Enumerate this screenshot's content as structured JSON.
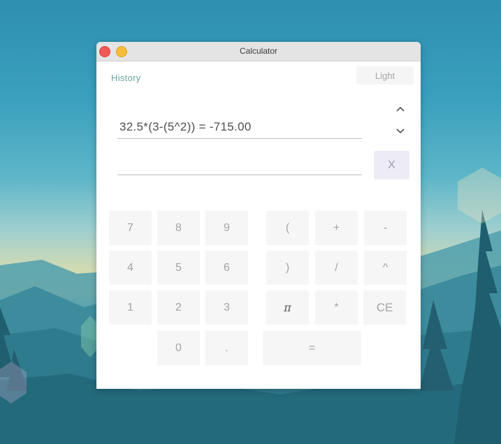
{
  "window": {
    "title": "Calculator"
  },
  "header": {
    "history_label": "History",
    "theme_label": "Light"
  },
  "display": {
    "expression": "32.5*(3-(5^2)) = -715.00",
    "input_value": "",
    "clear_label": "X"
  },
  "keypad": {
    "k7": "7",
    "k8": "8",
    "k9": "9",
    "k4": "4",
    "k5": "5",
    "k6": "6",
    "k1": "1",
    "k2": "2",
    "k3": "3",
    "k0": "0",
    "kdot": ".",
    "kopen": "(",
    "kplus": "+",
    "kminus": "-",
    "kclose": ")",
    "kdiv": "/",
    "kpow": "^",
    "kpi": "π",
    "kmul": "*",
    "kce": "CE",
    "keq": "="
  },
  "colors": {
    "accent_link": "#6aa6a1",
    "clear_bg": "#edecf6",
    "key_bg": "#f6f6f6"
  }
}
